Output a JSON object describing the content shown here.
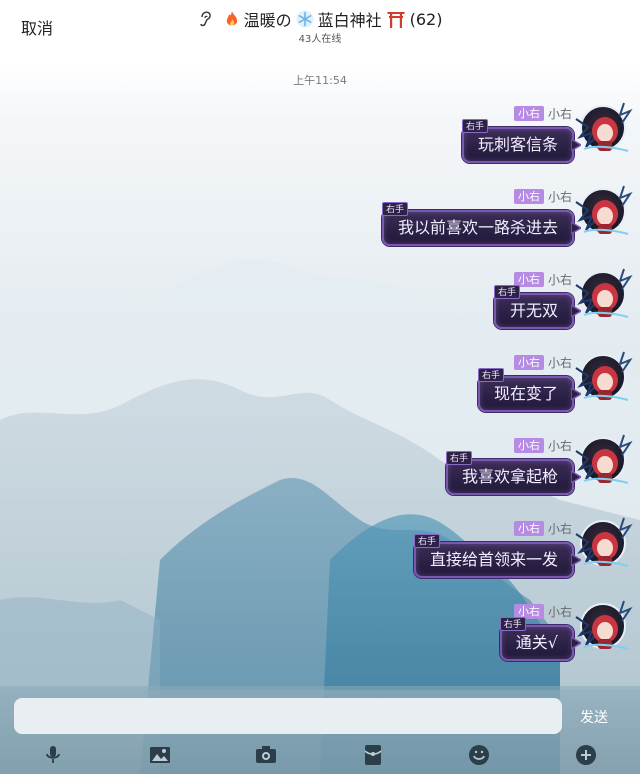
{
  "header": {
    "cancel_label": "取消",
    "title_part1": "温暖の",
    "title_part2": "蓝白神社",
    "title_count": "(62)",
    "online_text": "43人在线"
  },
  "timestamp": "上午11:54",
  "messages": [
    {
      "tag": "小右",
      "nick": "小右",
      "label": "右手",
      "text": "玩刺客信条"
    },
    {
      "tag": "小右",
      "nick": "小右",
      "label": "右手",
      "text": "我以前喜欢一路杀进去"
    },
    {
      "tag": "小右",
      "nick": "小右",
      "label": "右手",
      "text": "开无双"
    },
    {
      "tag": "小右",
      "nick": "小右",
      "label": "右手",
      "text": "现在变了"
    },
    {
      "tag": "小右",
      "nick": "小右",
      "label": "右手",
      "text": "我喜欢拿起枪"
    },
    {
      "tag": "小右",
      "nick": "小右",
      "label": "右手",
      "text": "直接给首领来一发"
    },
    {
      "tag": "小右",
      "nick": "小右",
      "label": "右手",
      "text": "通关√"
    }
  ],
  "input": {
    "value": "",
    "placeholder": "",
    "send_label": "发送"
  },
  "toolbar": {
    "icons": [
      "microphone-icon",
      "image-icon",
      "camera-icon",
      "red-packet-icon",
      "emoji-icon",
      "plus-icon"
    ]
  },
  "colors": {
    "tag_bg": "#b58be3",
    "bubble_bg": "#2a2044",
    "bubble_border": "#7a58b2",
    "fire": "#f5642a",
    "torii": "#d43b2a",
    "snow": "#6ab4e8"
  }
}
